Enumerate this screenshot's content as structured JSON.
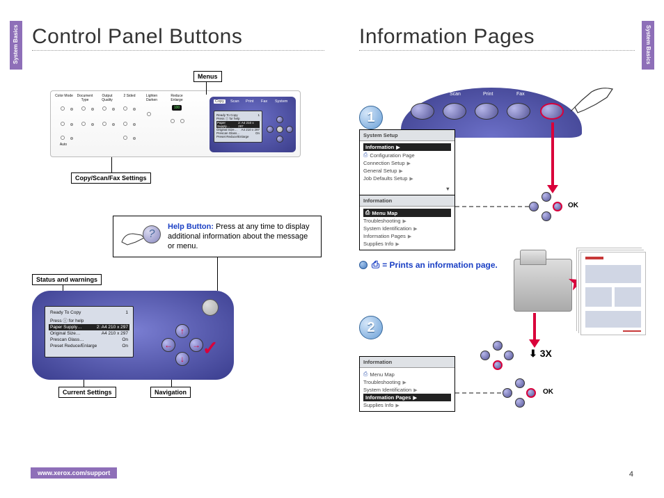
{
  "side_tab": "System Basics",
  "titles": {
    "left": "Control Panel Buttons",
    "right": "Information Pages"
  },
  "panel_labels": {
    "color_mode": "Color\nMode",
    "doc_type": "Document\nType",
    "output_quality": "Output\nQuality",
    "two_sided": "2 Sided",
    "lighten_darken": "Lighten\nDarken",
    "reduce_enlarge": "Reduce\nEnlarge",
    "auto": "Auto",
    "led": "100"
  },
  "blue_tabs": [
    "Copy",
    "Scan",
    "Print",
    "Fax",
    "System"
  ],
  "callouts": {
    "menus": "Menus",
    "copy_scan_fax": "Copy/Scan/Fax Settings",
    "status_warnings": "Status and warnings",
    "current_settings": "Current Settings",
    "navigation": "Navigation"
  },
  "help_box": {
    "title": "Help Button:",
    "text": "Press at any time to display additional information about the message or menu."
  },
  "status_screen": {
    "ready": "Ready To Copy",
    "ready_num": "1",
    "press_help": "Press ⓘ for help",
    "rows": [
      {
        "k": "Paper Supply…",
        "v": "2: A4 210 x 297",
        "hl": true
      },
      {
        "k": "Original Size…",
        "v": "A4 210 x 297"
      },
      {
        "k": "Prescan Glass…",
        "v": "On"
      },
      {
        "k": "Preset Reduce/Enlarge",
        "v": "On"
      }
    ]
  },
  "step1": "1",
  "step2": "2",
  "menu1": {
    "header": "System Setup",
    "rows": [
      {
        "t": "Information",
        "hl": true
      },
      {
        "t": "Configuration Page",
        "icon": true
      },
      {
        "t": "Connection Setup"
      },
      {
        "t": "General Setup"
      },
      {
        "t": "Job Defaults Setup"
      }
    ]
  },
  "menu2": {
    "header": "Information",
    "rows": [
      {
        "t": "Menu Map",
        "hl": true,
        "icon": true
      },
      {
        "t": "Troubleshooting"
      },
      {
        "t": "System Identification"
      },
      {
        "t": "Information Pages"
      },
      {
        "t": "Supplies Info"
      }
    ]
  },
  "menu3": {
    "header": "Information",
    "rows": [
      {
        "t": "Menu Map",
        "icon": true
      },
      {
        "t": "Troubleshooting"
      },
      {
        "t": "System Identification"
      },
      {
        "t": "Information Pages",
        "hl": true
      },
      {
        "t": "Supplies Info"
      }
    ]
  },
  "ok": "OK",
  "prints_label": "= Prints an information page.",
  "three_x": "3X",
  "footer_url": "www.xerox.com/support",
  "page_num": "4"
}
